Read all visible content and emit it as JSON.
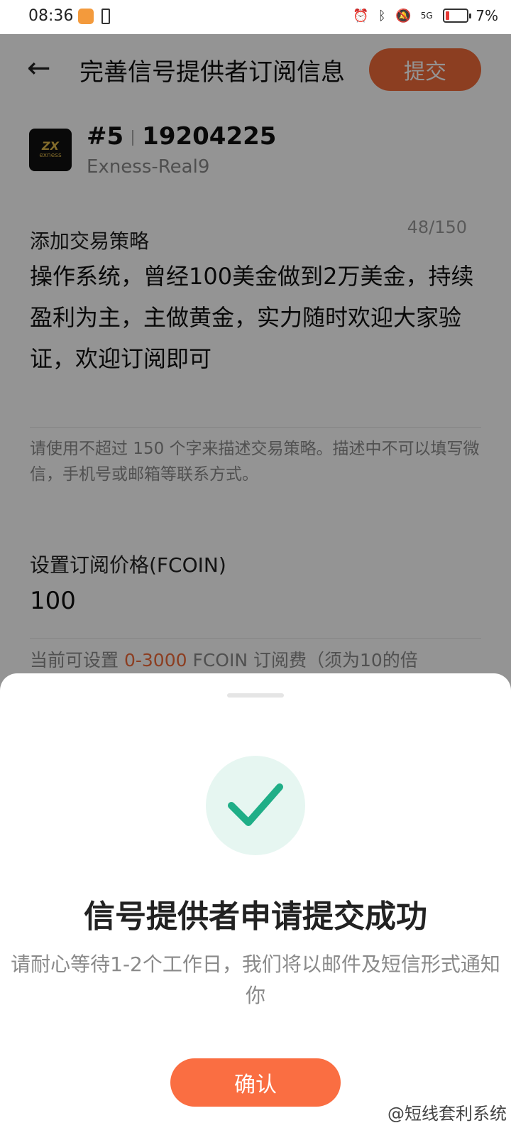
{
  "status_bar": {
    "time": "08:36",
    "battery": "7%",
    "signal": "5G"
  },
  "header": {
    "back_icon": "arrow-left-icon",
    "title": "完善信号提供者订阅信息",
    "submit_label": "提交"
  },
  "account": {
    "rank": "#5",
    "number": "19204225",
    "server": "Exness-Real9",
    "logo_text_top": "ZX",
    "logo_text_bottom": "exness"
  },
  "strategy": {
    "label": "添加交易策略",
    "counter": "48/150",
    "text": "操作系统，曾经100美金做到2万美金，持续盈利为主，主做黄金，实力随时欢迎大家验证，欢迎订阅即可",
    "hint": "请使用不超过 150 个字来描述交易策略。描述中不可以填写微信，手机号或邮箱等联系方式。"
  },
  "price": {
    "label": "设置订阅价格(FCOIN)",
    "value": "100",
    "hint_prefix": "当前可设置 ",
    "hint_range": "0-3000",
    "hint_suffix": " FCOIN 订阅费（须为10的倍"
  },
  "dialog": {
    "title": "信号提供者申请提交成功",
    "description": "请耐心等待1-2个工作日，我们将以邮件及短信形式通知你",
    "confirm_label": "确认",
    "watermark": "@短线套利系统"
  },
  "colors": {
    "accent": "#fa6e42",
    "success": "#1fae87",
    "success_bg": "#e6f6f1"
  }
}
